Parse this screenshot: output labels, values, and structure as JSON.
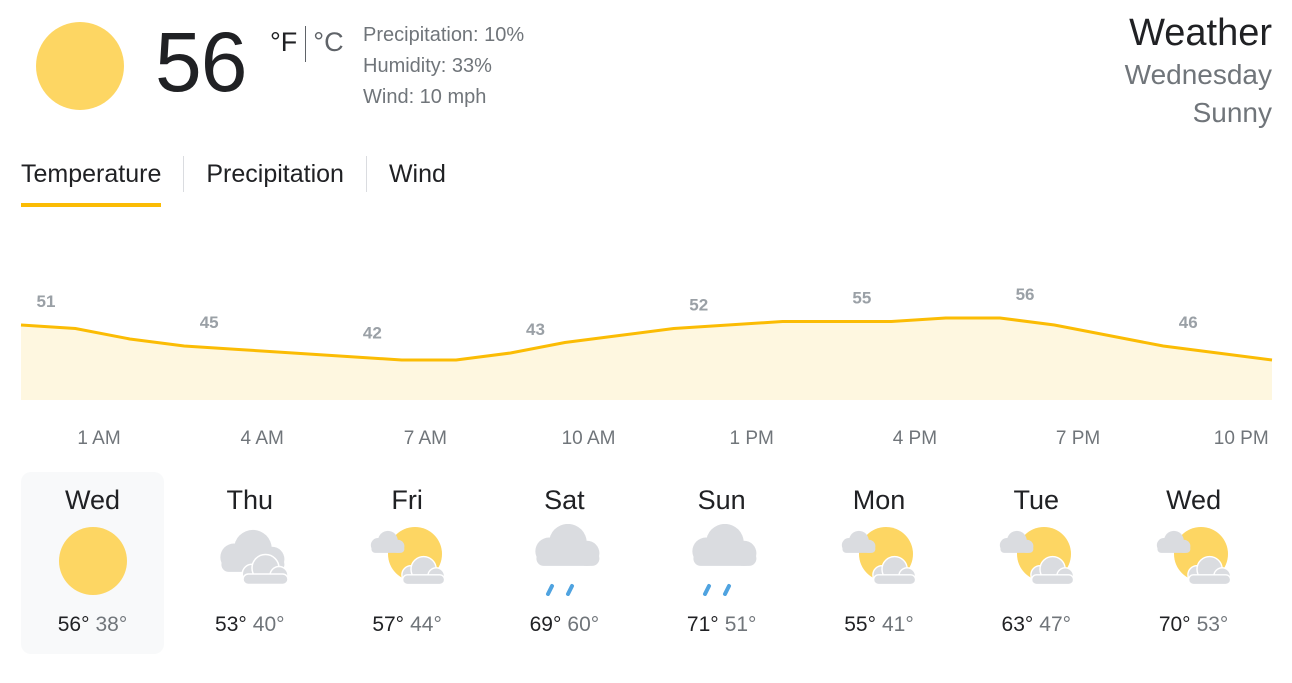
{
  "current": {
    "icon": "sun-icon",
    "temperature": "56",
    "unit_f": "°F",
    "unit_c": "°C",
    "precipitation": "Precipitation: 10%",
    "humidity": "Humidity: 33%",
    "wind": "Wind: 10 mph"
  },
  "header": {
    "title": "Weather",
    "day": "Wednesday",
    "condition": "Sunny"
  },
  "tabs": [
    {
      "label": "Temperature",
      "active": true
    },
    {
      "label": "Precipitation",
      "active": false
    },
    {
      "label": "Wind",
      "active": false
    }
  ],
  "colors": {
    "accent": "#fbbc04",
    "sun": "#fdd663",
    "cloud": "#dadce0",
    "rain": "#4fa3e0",
    "chart_fill": "#fef7e0"
  },
  "chart_data": {
    "type": "area",
    "x_labels": [
      "1 AM",
      "4 AM",
      "7 AM",
      "10 AM",
      "1 PM",
      "4 PM",
      "7 PM",
      "10 PM"
    ],
    "labeled_values": [
      51,
      45,
      42,
      43,
      52,
      55,
      56,
      46
    ],
    "hourly": [
      51,
      50,
      47,
      45,
      44,
      43,
      42,
      41,
      41,
      43,
      46,
      48,
      50,
      51,
      52,
      52,
      52,
      53,
      53,
      51,
      48,
      45,
      43,
      41
    ],
    "grid": false
  },
  "forecast": [
    {
      "day": "Wed",
      "icon": "sun-icon",
      "high": "56°",
      "low": "38°",
      "selected": true
    },
    {
      "day": "Thu",
      "icon": "cloudy-icon",
      "high": "53°",
      "low": "40°",
      "selected": false
    },
    {
      "day": "Fri",
      "icon": "partly-cloudy-icon",
      "high": "57°",
      "low": "44°",
      "selected": false
    },
    {
      "day": "Sat",
      "icon": "rain-icon",
      "high": "69°",
      "low": "60°",
      "selected": false
    },
    {
      "day": "Sun",
      "icon": "rain-icon",
      "high": "71°",
      "low": "51°",
      "selected": false
    },
    {
      "day": "Mon",
      "icon": "partly-cloudy-icon",
      "high": "55°",
      "low": "41°",
      "selected": false
    },
    {
      "day": "Tue",
      "icon": "partly-cloudy-icon",
      "high": "63°",
      "low": "47°",
      "selected": false
    },
    {
      "day": "Wed",
      "icon": "partly-cloudy-icon",
      "high": "70°",
      "low": "53°",
      "selected": false
    }
  ]
}
